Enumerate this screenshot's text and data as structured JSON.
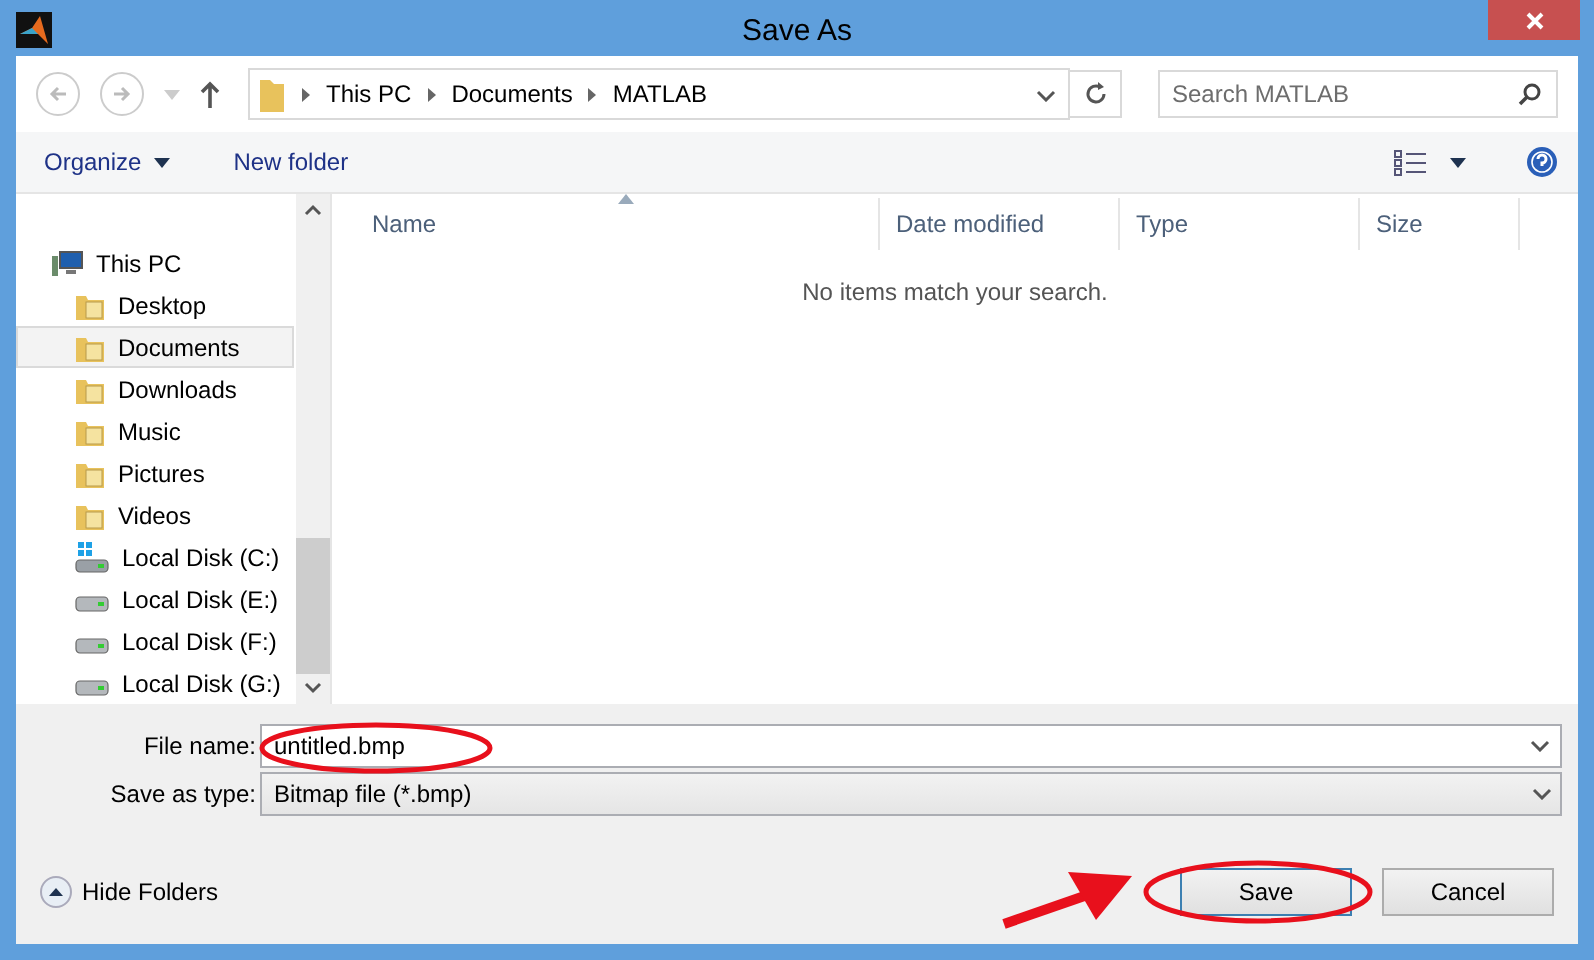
{
  "window": {
    "title": "Save As"
  },
  "address": {
    "crumbs": [
      "This PC",
      "Documents",
      "MATLAB"
    ]
  },
  "search": {
    "placeholder": "Search MATLAB"
  },
  "toolbar": {
    "organize": "Organize",
    "new_folder": "New folder"
  },
  "sidebar": {
    "items": [
      {
        "label": "This PC",
        "kind": "computer",
        "selected": false,
        "children": [
          {
            "label": "Desktop",
            "kind": "folder",
            "selected": false
          },
          {
            "label": "Documents",
            "kind": "folder",
            "selected": true
          },
          {
            "label": "Downloads",
            "kind": "folder",
            "selected": false
          },
          {
            "label": "Music",
            "kind": "folder",
            "selected": false
          },
          {
            "label": "Pictures",
            "kind": "folder",
            "selected": false
          },
          {
            "label": "Videos",
            "kind": "folder",
            "selected": false
          },
          {
            "label": "Local Disk (C:)",
            "kind": "system-drive",
            "selected": false
          },
          {
            "label": "Local Disk (E:)",
            "kind": "drive",
            "selected": false
          },
          {
            "label": "Local Disk (F:)",
            "kind": "drive",
            "selected": false
          },
          {
            "label": "Local Disk (G:)",
            "kind": "drive",
            "selected": false
          }
        ]
      }
    ]
  },
  "table": {
    "columns": [
      {
        "label": "Name",
        "sorted": true
      },
      {
        "label": "Date modified",
        "sorted": false
      },
      {
        "label": "Type",
        "sorted": false
      },
      {
        "label": "Size",
        "sorted": false
      }
    ],
    "empty_message": "No items match your search."
  },
  "file_name": {
    "label": "File name:",
    "value": "untitled.bmp",
    "highlighted": true
  },
  "save_type": {
    "label": "Save as type:",
    "value": "Bitmap file (*.bmp)"
  },
  "hide_folders": "Hide Folders",
  "buttons": [
    {
      "label": "Save",
      "default": true,
      "highlighted": true
    },
    {
      "label": "Cancel",
      "default": false,
      "highlighted": false
    }
  ]
}
